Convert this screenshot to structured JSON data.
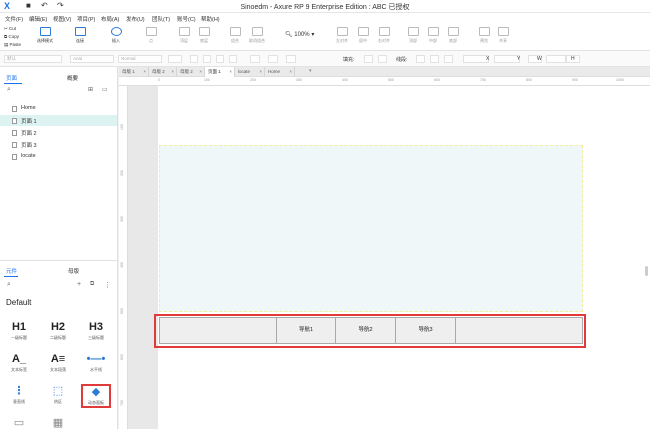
{
  "app": {
    "title": "Sinoedm - Axure RP 9 Enterprise Edition : ABC 已授权",
    "logo": "X"
  },
  "menu": [
    "文件(F)",
    "编辑(E)",
    "视图(V)",
    "项目(P)",
    "布局(A)",
    "发布(U)",
    "团队(T)",
    "账号(C)",
    "帮助(H)"
  ],
  "clipboard": {
    "cut": "Cut",
    "copy": "Copy",
    "paste": "Paste"
  },
  "toolbar": {
    "select_mode": "选择模式",
    "connect": "连接",
    "insert": "插入",
    "point": "点",
    "top": "顶层",
    "bottom": "底层",
    "group": "组合",
    "ungroup": "取消组合",
    "zoom": "100%",
    "left": "左对齐",
    "center": "居中",
    "right": "右对齐",
    "top_align": "顶部",
    "middle": "中部",
    "bottom_align": "底部",
    "preview": "预览",
    "share": "共享"
  },
  "formatbar": {
    "style": "默认",
    "font": "Arial",
    "weight": "Normal",
    "fill_label": "填充:",
    "line_label": "线段:",
    "x_label": "X",
    "y_label": "Y",
    "w_label": "W",
    "h_label": "H"
  },
  "pages_panel": {
    "tab_pages": "页面",
    "tab_outline": "概要",
    "pages": [
      {
        "label": "Home",
        "selected": false
      },
      {
        "label": "页面 1",
        "selected": true
      },
      {
        "label": "页面 2",
        "selected": false
      },
      {
        "label": "页面 3",
        "selected": false
      },
      {
        "label": "locate",
        "selected": false
      }
    ]
  },
  "library_panel": {
    "tab_widgets": "元件",
    "tab_masters": "母版",
    "library_name": "Default",
    "widgets": [
      {
        "glyph": "H1",
        "label": "一级标题"
      },
      {
        "glyph": "H2",
        "label": "二级标题"
      },
      {
        "glyph": "H3",
        "label": "三级标题"
      },
      {
        "glyph": "A_",
        "label": "文本标签"
      },
      {
        "glyph": "A≡",
        "label": "文本段落"
      },
      {
        "glyph": "•—•",
        "label": "水平线"
      },
      {
        "glyph": "⋮",
        "label": "垂直线"
      },
      {
        "glyph": "⬚",
        "label": "热区"
      },
      {
        "glyph": "◆",
        "label": "动态面板",
        "selected": true
      }
    ]
  },
  "doc_tabs": [
    {
      "label": "母版 1",
      "active": false
    },
    {
      "label": "母版 2",
      "active": false
    },
    {
      "label": "母版 2",
      "active": false
    },
    {
      "label": "页面 1",
      "active": true
    },
    {
      "label": "locate",
      "active": false
    },
    {
      "label": "Home",
      "active": false
    }
  ],
  "ruler": {
    "h_ticks": [
      "0",
      "100",
      "200",
      "300",
      "400",
      "500",
      "600",
      "700",
      "800",
      "900",
      "1000"
    ],
    "v_ticks": [
      "100",
      "200",
      "300",
      "400",
      "500",
      "600",
      "700",
      "800"
    ]
  },
  "canvas": {
    "nav_items": [
      "导航1",
      "导航2",
      "导航3"
    ]
  },
  "colors": {
    "accent": "#1a73e8",
    "highlight_red": "#e03a3a",
    "selected_page_bg": "#dcf3f1",
    "panel_bg": "#eff7f8"
  }
}
